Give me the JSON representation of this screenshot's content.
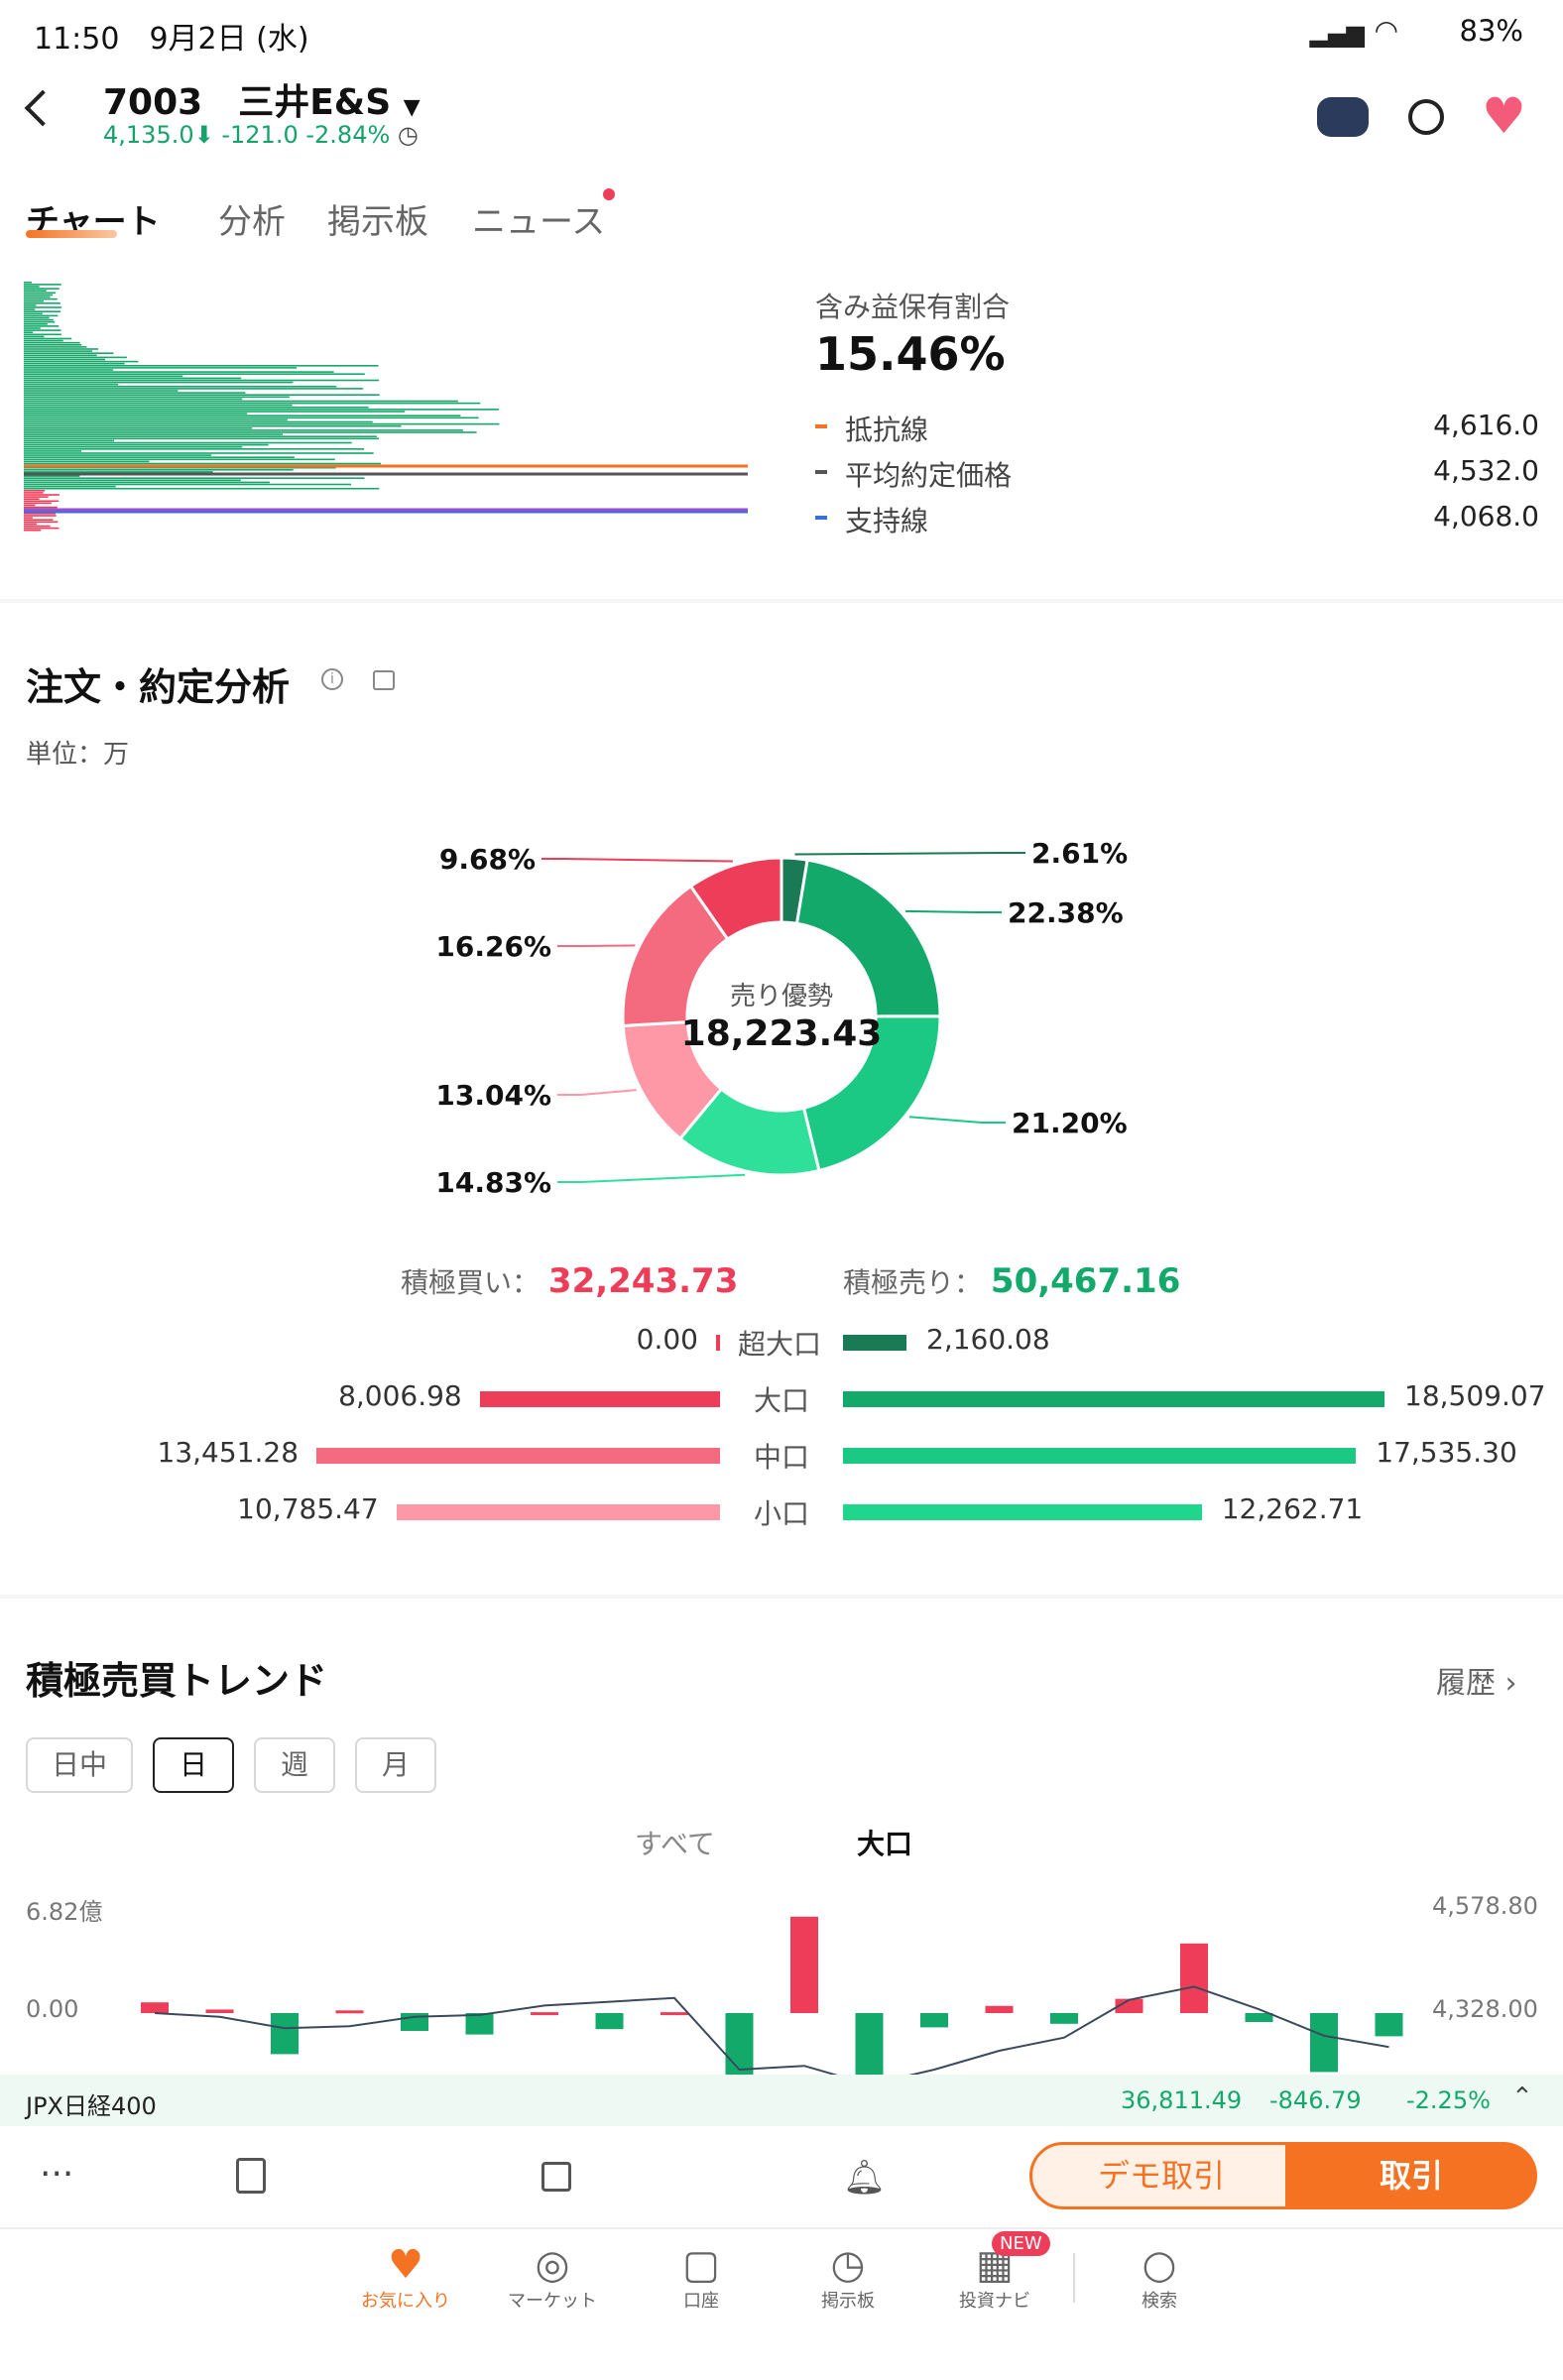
{
  "status": {
    "time": "11:50",
    "date": "9月2日 (水)",
    "battery": "83%"
  },
  "header": {
    "code": "7003",
    "name": "三井E&S",
    "price": "4,135.0",
    "change": "-121.0",
    "change_pct": "-2.84%"
  },
  "tabs": [
    "チャート",
    "分析",
    "掲示板",
    "ニュース"
  ],
  "profit": {
    "label": "含み益保有割合",
    "value": "15.46%",
    "lines": [
      {
        "name": "抵抗線",
        "value": "4,616.0",
        "color": "#f57223"
      },
      {
        "name": "平均約定価格",
        "value": "4,532.0",
        "color": "#555555"
      },
      {
        "name": "支持線",
        "value": "4,068.0",
        "color": "#3a6fd8"
      }
    ]
  },
  "order": {
    "title": "注文・約定分析",
    "unit": "単位：万",
    "donut_label": "売り優勢",
    "donut_value": "18,223.43",
    "slices": [
      {
        "label": "2.61%",
        "value": 2.61,
        "color": "#1a7a55"
      },
      {
        "label": "22.38%",
        "value": 22.38,
        "color": "#12a96b"
      },
      {
        "label": "21.20%",
        "value": 21.2,
        "color": "#1cc984"
      },
      {
        "label": "14.83%",
        "value": 14.83,
        "color": "#2fe09b"
      },
      {
        "label": "13.04%",
        "value": 13.04,
        "color": "#ff98a6"
      },
      {
        "label": "16.26%",
        "value": 16.26,
        "color": "#f46b7f"
      },
      {
        "label": "9.68%",
        "value": 9.68,
        "color": "#ee3d58"
      }
    ],
    "buy_label": "積極買い：",
    "buy_total": "32,243.73",
    "sell_label": "積極売り：",
    "sell_total": "50,467.16",
    "rows": [
      {
        "name": "超大口",
        "buy": "0.00",
        "sell": "2,160.08",
        "buy_v": 0,
        "sell_v": 2160.08
      },
      {
        "name": "大口",
        "buy": "8,006.98",
        "sell": "18,509.07",
        "buy_v": 8006.98,
        "sell_v": 18509.07
      },
      {
        "name": "中口",
        "buy": "13,451.28",
        "sell": "17,535.30",
        "buy_v": 13451.28,
        "sell_v": 17535.3
      },
      {
        "name": "小口",
        "buy": "10,785.47",
        "sell": "12,262.71",
        "buy_v": 10785.47,
        "sell_v": 12262.71
      }
    ]
  },
  "trend": {
    "title": "積極売買トレンド",
    "history": "履歴",
    "periods": [
      "日中",
      "日",
      "週",
      "月"
    ],
    "filters": [
      "すべて",
      "大口"
    ],
    "y_left": [
      "6.82億",
      "0.00"
    ],
    "y_right": [
      "4,578.80",
      "4,328.00"
    ]
  },
  "chart_data": {
    "type": "bar",
    "bars": [
      0.6,
      0.2,
      -2.3,
      0.15,
      -1,
      -1.2,
      0.05,
      -0.9,
      0.05,
      -5.5,
      5.4,
      -5.5,
      -0.8,
      0.4,
      -0.6,
      0.8,
      3.9,
      -0.5,
      -3.3,
      -1.3
    ],
    "line": [
      4328,
      4326,
      4320,
      4321,
      4326,
      4327,
      4332,
      4334,
      4336,
      4298,
      4300,
      4290,
      4298,
      4308,
      4315,
      4335,
      4342,
      4330,
      4316,
      4310
    ]
  },
  "ticker": {
    "name": "JPX日経400",
    "value": "36,811.49",
    "change": "-846.79",
    "pct": "-2.25%"
  },
  "actions": {
    "demo": "デモ取引",
    "trade": "取引"
  },
  "nav": [
    "お気に入り",
    "マーケット",
    "口座",
    "掲示板",
    "投資ナビ",
    "検索"
  ],
  "nav_badge": "NEW"
}
